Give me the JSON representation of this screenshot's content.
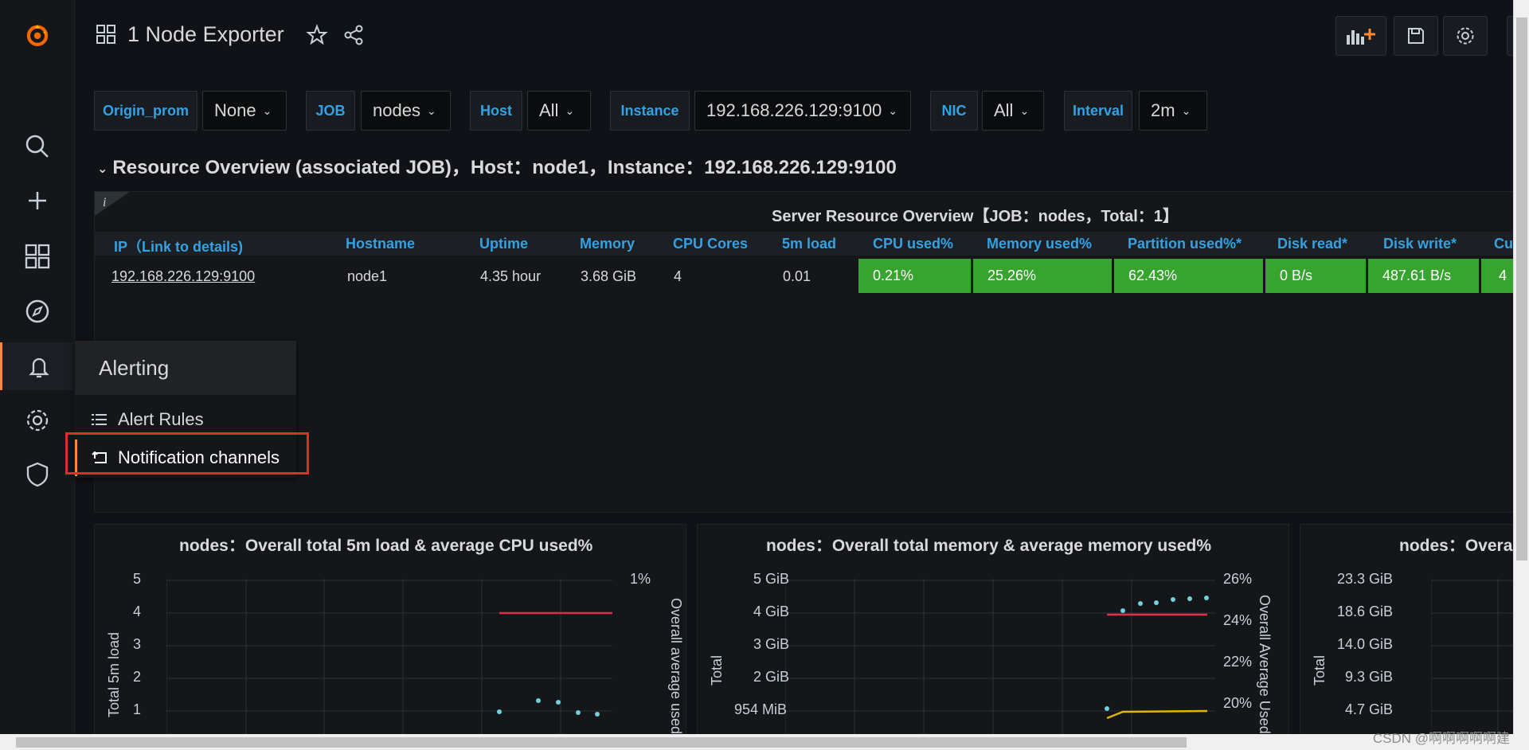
{
  "topbar": {
    "title": "1 Node Exporter"
  },
  "variables": [
    {
      "label": "Origin_prom",
      "value": "None"
    },
    {
      "label": "JOB",
      "value": "nodes"
    },
    {
      "label": "Host",
      "value": "All"
    },
    {
      "label": "Instance",
      "value": "192.168.226.129:9100"
    },
    {
      "label": "NIC",
      "value": "All"
    },
    {
      "label": "Interval",
      "value": "2m"
    }
  ],
  "row": {
    "title": "Resource Overview (associated JOB)，Host：node1，Instance：192.168.226.129:9100"
  },
  "table": {
    "title": "Server Resource Overview【JOB：nodes，Total：1】",
    "info_icon": "i",
    "columns": [
      "IP（Link to details)",
      "Hostname",
      "Uptime",
      "Memory",
      "CPU Cores",
      "5m load",
      "CPU used%",
      "Memory used%",
      "Partition used%*",
      "Disk read*",
      "Disk write*",
      "Cu"
    ],
    "row": {
      "ip": "192.168.226.129:9100",
      "hostname": "node1",
      "uptime": "4.35 hour",
      "memory": "3.68 GiB",
      "cpu_cores": "4",
      "load": "0.01",
      "cpu_used": "0.21%",
      "memory_used": "25.26%",
      "partition_used": "62.43%",
      "disk_read": "0 B/s",
      "disk_write": "487.61 B/s",
      "last": "4"
    }
  },
  "flyout": {
    "title": "Alerting",
    "items": [
      "Alert Rules",
      "Notification channels"
    ]
  },
  "graphs": [
    {
      "title": "nodes：Overall total 5m load & average CPU used%",
      "y_ticks": [
        "5",
        "4",
        "3",
        "2",
        "1"
      ],
      "y2_ticks": [
        "1%"
      ],
      "ylabel": "Total 5m load",
      "y2label": "Overall average used"
    },
    {
      "title": "nodes：Overall total memory & average memory used%",
      "y_ticks": [
        "5 GiB",
        "4 GiB",
        "3 GiB",
        "2 GiB",
        "954 MiB"
      ],
      "y2_ticks": [
        "26%",
        "24%",
        "22%",
        "20%"
      ],
      "ylabel": "Total",
      "y2label": "Overall Average Used"
    },
    {
      "title": "nodes：Overal",
      "y_ticks": [
        "23.3 GiB",
        "18.6 GiB",
        "14.0 GiB",
        "9.3 GiB",
        "4.7 GiB"
      ],
      "ylabel": "Total"
    }
  ],
  "watermark": "CSDN @啊啊啊啊啊建",
  "colors": {
    "accent": "#33a2e5",
    "green_cell": "#37a42f",
    "active_bar": "#ff8833",
    "highlight_box": "#e02c2c",
    "series_red": "#e02f44",
    "series_yellow": "#e0b400",
    "series_cyan": "#6ed0e0"
  }
}
